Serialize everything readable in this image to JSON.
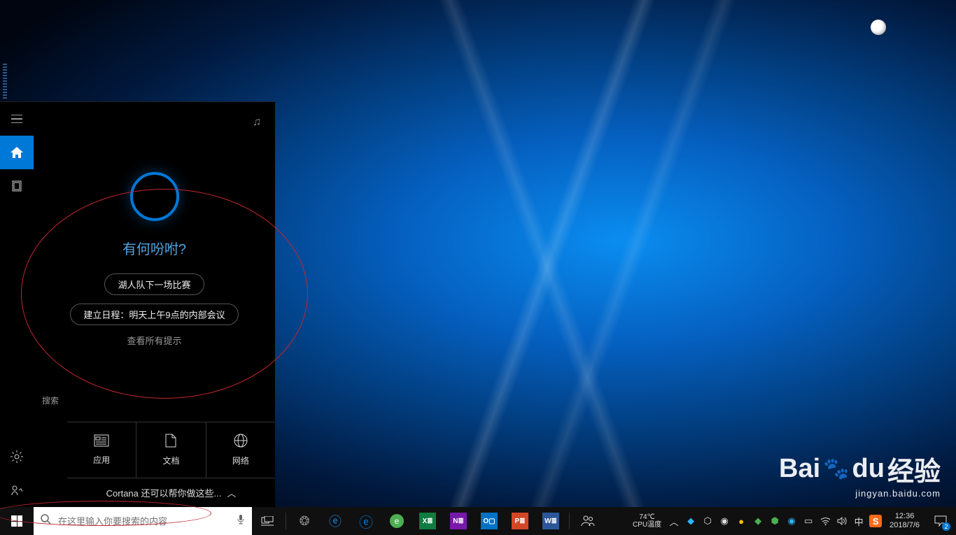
{
  "desktop": {
    "soccer_icon_name": "soccer-ball-icon"
  },
  "cortana": {
    "sidebar": {
      "menu": "menu",
      "home": "home",
      "notebook": "notebook",
      "settings": "settings",
      "feedback": "feedback"
    },
    "music_label": "music",
    "prompt": "有何吩咐?",
    "chips": [
      "湖人队下一场比赛",
      "建立日程：明天上午9点的内部会议"
    ],
    "all_tips": "查看所有提示",
    "search_label": "搜索",
    "tabs": [
      {
        "icon": "⊞",
        "label": "应用"
      },
      {
        "icon": "🗎",
        "label": "文档"
      },
      {
        "icon": "⊕",
        "label": "网络"
      }
    ],
    "more": "Cortana 还可以帮你做这些...",
    "more_chevron": "︿"
  },
  "taskbar": {
    "search_placeholder": "在这里输入你要搜索的内容",
    "apps": [
      "task-view",
      "app1",
      "ie",
      "edge",
      "360",
      "excel",
      "onenote",
      "outlook",
      "powerpoint",
      "word"
    ],
    "people": "people",
    "cpu": {
      "temp": "74℃",
      "label": "CPU温度"
    },
    "clock": {
      "time": "12:36",
      "date": "2018/7/6"
    },
    "notif_count": "2",
    "ime": "中"
  },
  "watermark": {
    "main1": "Bai",
    "main2": "du",
    "main3": "经验",
    "sub": "jingyan.baidu.com"
  }
}
